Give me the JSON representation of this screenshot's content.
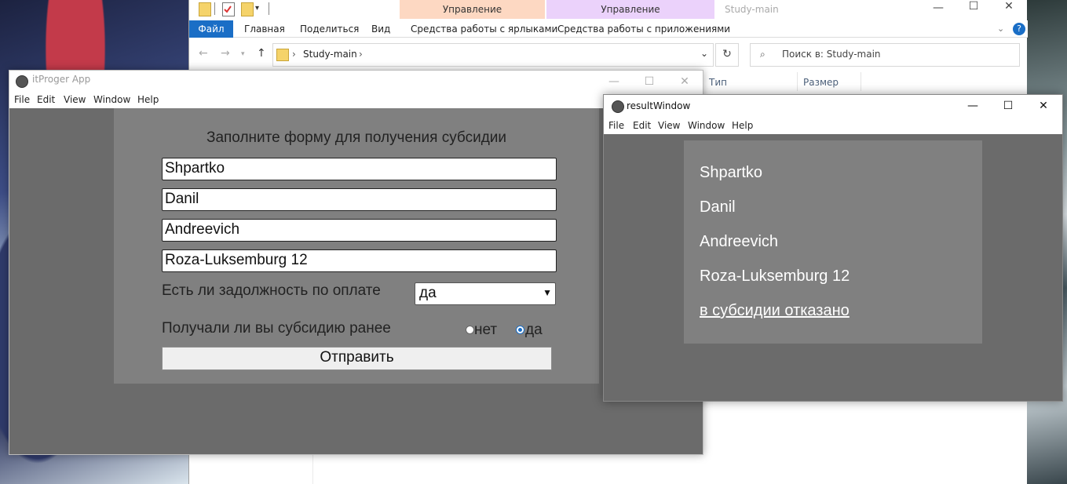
{
  "explorer": {
    "title": "Study-main",
    "context_groups": [
      {
        "label": "Управление",
        "color": "#fdd8c2"
      },
      {
        "label": "Управление",
        "color": "#ebd2fb"
      }
    ],
    "ribbon": {
      "file_tab": "Файл",
      "tabs": [
        "Главная",
        "Поделиться",
        "Вид"
      ],
      "context_tabs": [
        "Средства работы с ярлыками",
        "Средства работы с приложениями"
      ]
    },
    "breadcrumb": "Study-main",
    "search_placeholder": "Поиск в: Study-main",
    "columns": [
      "Тип",
      "Размер"
    ]
  },
  "app_window": {
    "title": "itProger App",
    "menu": [
      "File",
      "Edit",
      "View",
      "Window",
      "Help"
    ],
    "form": {
      "title": "Заполните форму для получения субсидии",
      "surname": "Shpartko",
      "name": "Danil",
      "patronymic": "Andreevich",
      "address": "Roza-Luksemburg 12",
      "debt_label": "Есть ли задолжность по оплате",
      "debt_value": "да",
      "prior_label": "Получали ли вы субсидию ранее",
      "radio_no": "нет",
      "radio_yes": "да",
      "selected_radio": "да",
      "submit": "Отправить"
    }
  },
  "result_window": {
    "title": "resultWindow",
    "menu": [
      "File",
      "Edit",
      "View",
      "Window",
      "Help"
    ],
    "lines": [
      "Shpartko",
      "Danil",
      "Andreevich",
      "Roza-Luksemburg 12"
    ],
    "verdict": "в субсидии отказано"
  }
}
